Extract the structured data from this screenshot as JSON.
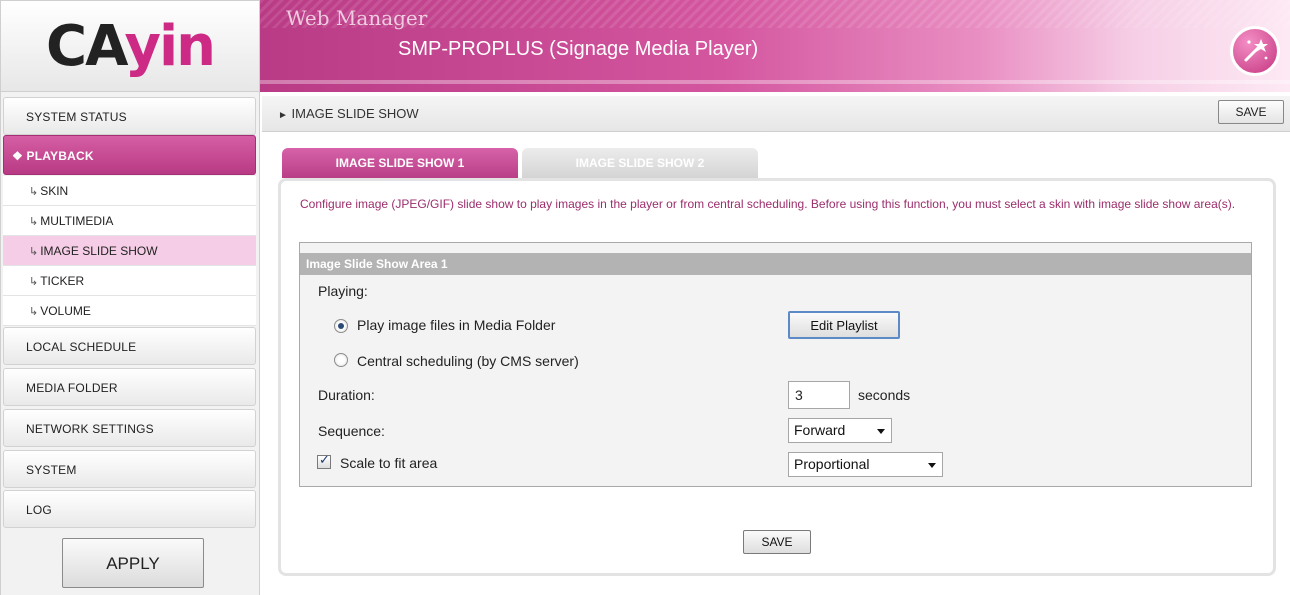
{
  "logo": {
    "text_main": "CA",
    "text_accent": "yin"
  },
  "header": {
    "brand": "Web Manager",
    "product": "SMP-PROPLUS (Signage Media Player)",
    "icon": "magic-wand-icon"
  },
  "sidebar": {
    "items": [
      {
        "label": "SYSTEM STATUS"
      },
      {
        "label": "PLAYBACK"
      },
      {
        "label": "LOCAL SCHEDULE"
      },
      {
        "label": "MEDIA FOLDER"
      },
      {
        "label": "NETWORK SETTINGS"
      },
      {
        "label": "SYSTEM"
      },
      {
        "label": "LOG"
      }
    ],
    "playback_marker": "❖",
    "sub_items": [
      {
        "label": "SKIN"
      },
      {
        "label": "MULTIMEDIA"
      },
      {
        "label": "IMAGE SLIDE SHOW"
      },
      {
        "label": "TICKER"
      },
      {
        "label": "VOLUME"
      }
    ],
    "sub_arrow": "↳",
    "apply_label": "APPLY"
  },
  "page": {
    "title_marker": "►",
    "title": "IMAGE SLIDE SHOW",
    "save_label": "SAVE",
    "tabs": [
      {
        "label": "IMAGE SLIDE SHOW 1"
      },
      {
        "label": "IMAGE SLIDE SHOW 2"
      }
    ],
    "description": "Configure image (JPEG/GIF) slide show to play images in the player or from central scheduling. Before using this function, you must select a skin with image slide show area(s).",
    "area": {
      "header": "Image Slide Show Area 1",
      "playing_label": "Playing:",
      "option_media_folder": "Play image files in Media Folder",
      "option_central": "Central scheduling (by CMS server)",
      "edit_playlist_label": "Edit Playlist",
      "duration_label": "Duration:",
      "duration_value": "3",
      "duration_unit": "seconds",
      "sequence_label": "Sequence:",
      "sequence_value": "Forward",
      "scale_label": "Scale to fit area",
      "scale_value": "Proportional"
    },
    "bottom_save_label": "SAVE"
  },
  "colors": {
    "accent": "#c0428c",
    "description_text": "#9b2e6c",
    "selected_sub_bg": "#f6cde6"
  }
}
